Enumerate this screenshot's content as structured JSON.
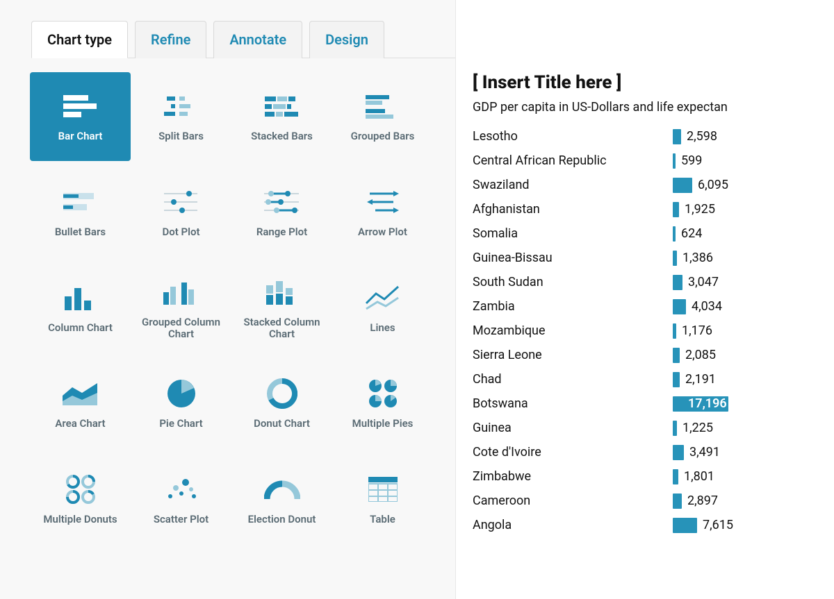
{
  "colors": {
    "accent": "#1f8ab3",
    "accent_light": "#95c8da",
    "text": "#111",
    "muted": "#5a6b74"
  },
  "tabs": [
    {
      "id": "chart-type",
      "label": "Chart type",
      "active": true
    },
    {
      "id": "refine",
      "label": "Refine",
      "active": false
    },
    {
      "id": "annotate",
      "label": "Annotate",
      "active": false
    },
    {
      "id": "design",
      "label": "Design",
      "active": false
    }
  ],
  "chart_types": [
    {
      "id": "bar-chart",
      "label": "Bar Chart",
      "selected": true
    },
    {
      "id": "split-bars",
      "label": "Split Bars",
      "selected": false
    },
    {
      "id": "stacked-bars",
      "label": "Stacked Bars",
      "selected": false
    },
    {
      "id": "grouped-bars",
      "label": "Grouped Bars",
      "selected": false
    },
    {
      "id": "bullet-bars",
      "label": "Bullet Bars",
      "selected": false
    },
    {
      "id": "dot-plot",
      "label": "Dot Plot",
      "selected": false
    },
    {
      "id": "range-plot",
      "label": "Range Plot",
      "selected": false
    },
    {
      "id": "arrow-plot",
      "label": "Arrow Plot",
      "selected": false
    },
    {
      "id": "column-chart",
      "label": "Column Chart",
      "selected": false
    },
    {
      "id": "grouped-column-chart",
      "label": "Grouped Column Chart",
      "selected": false
    },
    {
      "id": "stacked-column-chart",
      "label": "Stacked Column Chart",
      "selected": false
    },
    {
      "id": "lines",
      "label": "Lines",
      "selected": false
    },
    {
      "id": "area-chart",
      "label": "Area Chart",
      "selected": false
    },
    {
      "id": "pie-chart",
      "label": "Pie Chart",
      "selected": false
    },
    {
      "id": "donut-chart",
      "label": "Donut Chart",
      "selected": false
    },
    {
      "id": "multiple-pies",
      "label": "Multiple Pies",
      "selected": false
    },
    {
      "id": "multiple-donuts",
      "label": "Multiple Donuts",
      "selected": false
    },
    {
      "id": "scatter-plot",
      "label": "Scatter Plot",
      "selected": false
    },
    {
      "id": "election-donut",
      "label": "Election Donut",
      "selected": false
    },
    {
      "id": "table",
      "label": "Table",
      "selected": false
    }
  ],
  "preview": {
    "title": "[ Insert Title here ]",
    "subtitle": "GDP per capita in US-Dollars and life expectan"
  },
  "chart_data": {
    "type": "bar",
    "title": "[ Insert Title here ]",
    "subtitle": "GDP per capita in US-Dollars and life expectan",
    "xlabel": "",
    "ylabel": "",
    "categories": [
      "Lesotho",
      "Central African Republic",
      "Swaziland",
      "Afghanistan",
      "Somalia",
      "Guinea-Bissau",
      "South Sudan",
      "Zambia",
      "Mozambique",
      "Sierra Leone",
      "Chad",
      "Botswana",
      "Guinea",
      "Cote d'Ivoire",
      "Zimbabwe",
      "Cameroon",
      "Angola"
    ],
    "values": [
      2598,
      599,
      6095,
      1925,
      624,
      1386,
      3047,
      4034,
      1176,
      2085,
      2191,
      17196,
      1225,
      3491,
      1801,
      2897,
      7615
    ],
    "value_labels": [
      "2,598",
      "599",
      "6,095",
      "1,925",
      "624",
      "1,386",
      "3,047",
      "4,034",
      "1,176",
      "2,085",
      "2,191",
      "17,196",
      "1,225",
      "3,491",
      "1,801",
      "2,897",
      "7,615"
    ],
    "xlim": [
      0,
      17196
    ]
  }
}
